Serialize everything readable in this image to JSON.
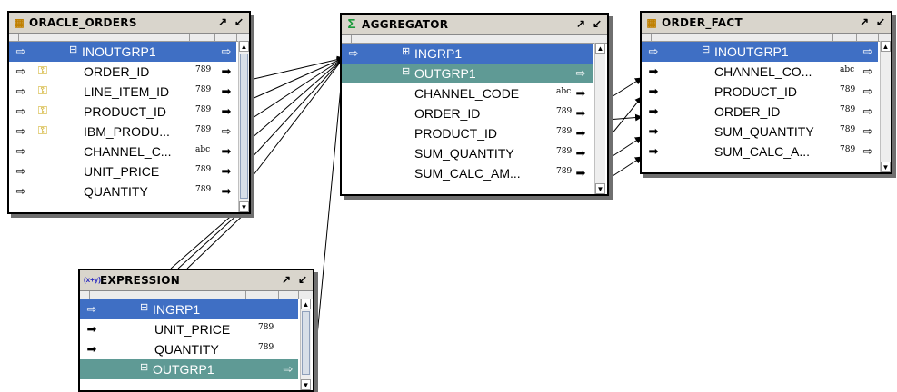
{
  "colors": {
    "group_row": "#3f6fc4",
    "output_group_row": "#5f9a95",
    "titlebar": "#d9d5cc",
    "link": "#000000"
  },
  "oracle_orders": {
    "title": "ORACLE_ORDERS",
    "title_icon": "table-icon",
    "group": "INOUTGRP1",
    "ports": [
      {
        "name": "ORDER_ID",
        "type": "789",
        "key": true
      },
      {
        "name": "LINE_ITEM_ID",
        "type": "789",
        "key": true
      },
      {
        "name": "PRODUCT_ID",
        "type": "789",
        "key": true
      },
      {
        "name": "IBM_PRODU...",
        "type": "789",
        "key": true
      },
      {
        "name": "CHANNEL_C...",
        "type": "abc",
        "key": false
      },
      {
        "name": "UNIT_PRICE",
        "type": "789",
        "key": false
      },
      {
        "name": "QUANTITY",
        "type": "789",
        "key": false
      }
    ]
  },
  "aggregator": {
    "title": "AGGREGATOR",
    "title_icon": "sigma-icon",
    "in_group": "INGRP1",
    "out_group": "OUTGRP1",
    "ports": [
      {
        "name": "CHANNEL_CODE",
        "type": "abc"
      },
      {
        "name": "ORDER_ID",
        "type": "789"
      },
      {
        "name": "PRODUCT_ID",
        "type": "789"
      },
      {
        "name": "SUM_QUANTITY",
        "type": "789"
      },
      {
        "name": "SUM_CALC_AM...",
        "type": "789"
      }
    ]
  },
  "order_fact": {
    "title": "ORDER_FACT",
    "title_icon": "table-icon",
    "group": "INOUTGRP1",
    "ports": [
      {
        "name": "CHANNEL_CO...",
        "type": "abc"
      },
      {
        "name": "PRODUCT_ID",
        "type": "789"
      },
      {
        "name": "ORDER_ID",
        "type": "789"
      },
      {
        "name": "SUM_QUANTITY",
        "type": "789"
      },
      {
        "name": "SUM_CALC_A...",
        "type": "789"
      }
    ]
  },
  "expression": {
    "title": "EXPRESSION",
    "title_icon": "expression-icon",
    "in_group": "INGRP1",
    "ports": [
      {
        "name": "UNIT_PRICE",
        "type": "789"
      },
      {
        "name": "QUANTITY",
        "type": "789"
      }
    ],
    "out_group": "OUTGRP1"
  }
}
